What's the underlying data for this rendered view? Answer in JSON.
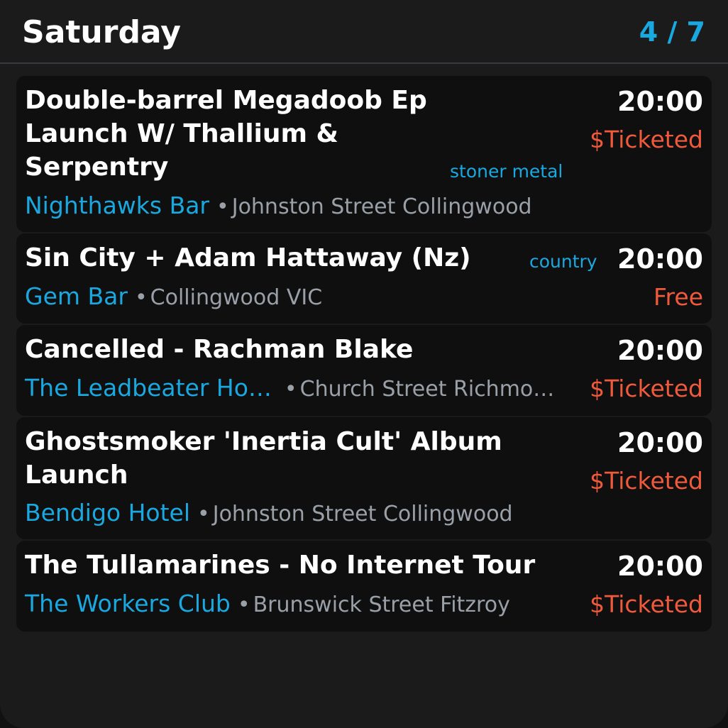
{
  "header": {
    "title": "Saturday",
    "counter": "4 / 7"
  },
  "separator": "•",
  "events": [
    {
      "title_lines": [
        "Double-barrel Megadoob Ep",
        "Launch W/ Thallium &",
        "Serpentry"
      ],
      "time": "20:00",
      "price": "$Ticketed",
      "genre": "stoner metal",
      "venue": "Nighthawks Bar",
      "location": "Johnston Street Collingwood"
    },
    {
      "title_lines": [
        "Sin City + Adam Hattaway (Nz)"
      ],
      "time": "20:00",
      "price": "Free",
      "genre": "country",
      "venue": "Gem Bar",
      "location": "Collingwood VIC"
    },
    {
      "title_lines": [
        "Cancelled - Rachman Blake"
      ],
      "time": "20:00",
      "price": "$Ticketed",
      "genre": "",
      "venue": "The Leadbeater Ho…",
      "location": "Church Street Richmo…"
    },
    {
      "title_lines": [
        "Ghostsmoker 'Inertia Cult' Album",
        "Launch"
      ],
      "time": "20:00",
      "price": "$Ticketed",
      "genre": "",
      "venue": "Bendigo Hotel",
      "location": "Johnston Street Collingwood"
    },
    {
      "title_lines": [
        "The Tullamarines - No Internet Tour"
      ],
      "time": "20:00",
      "price": "$Ticketed",
      "genre": "",
      "venue": "The Workers Club",
      "location": "Brunswick Street Fitzroy"
    }
  ]
}
